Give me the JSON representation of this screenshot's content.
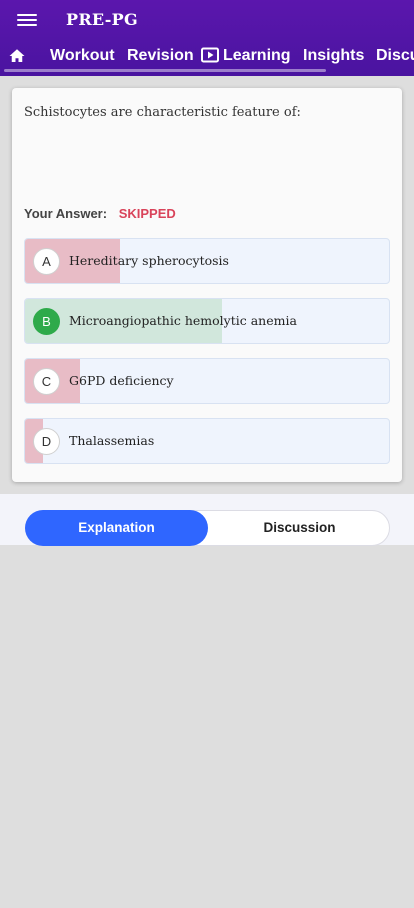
{
  "app": {
    "title": "PRE-PG"
  },
  "icons": {
    "menu": "hamburger-menu-icon",
    "home": "home-icon",
    "learning": "play-video-icon"
  },
  "colors": {
    "header": "#4a14a0",
    "accent": "#2f66ff",
    "skipped": "#d9435a",
    "correct": "#2eaa4a",
    "wrong_fill": "#e8bcc6",
    "correct_fill": "#d1e7dc"
  },
  "nav": {
    "tabs": [
      "Workout",
      "Revision",
      "Learning",
      "Insights",
      "Discuss"
    ]
  },
  "question": {
    "text": "Schistocytes are characteristic feature of:",
    "answer_label": "Your Answer:",
    "answer_value": "SKIPPED",
    "options": [
      {
        "letter": "A",
        "text": "Hereditary spherocytosis",
        "response_fraction": 0.26,
        "correct": false
      },
      {
        "letter": "B",
        "text": "Microangiopathic hemolytic anemia",
        "response_fraction": 0.54,
        "correct": true
      },
      {
        "letter": "C",
        "text": "G6PD deficiency",
        "response_fraction": 0.15,
        "correct": false
      },
      {
        "letter": "D",
        "text": "Thalassemias",
        "response_fraction": 0.05,
        "correct": false
      }
    ]
  },
  "segments": {
    "explanation": "Explanation",
    "discussion": "Discussion"
  }
}
